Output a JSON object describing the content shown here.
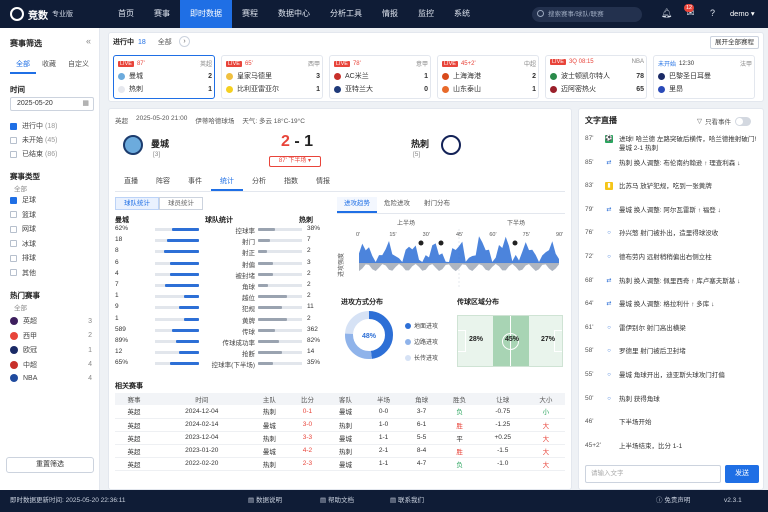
{
  "app": {
    "name": "竞数",
    "edition": "专业版"
  },
  "nav": [
    "首页",
    "赛事",
    "即时数据",
    "赛程",
    "数据中心",
    "分析工具",
    "情报",
    "监控",
    "系统"
  ],
  "search_placeholder": "搜索赛事/球队/联赛",
  "notif_count": "12",
  "user": "demo",
  "sidebar": {
    "title": "赛事筛选",
    "tabs": [
      "全部",
      "收藏",
      "自定义"
    ],
    "time_label": "时间",
    "date": "2025-05-20",
    "status": [
      {
        "label": "进行中",
        "count": "(18)",
        "checked": true
      },
      {
        "label": "未开始",
        "count": "(45)",
        "checked": false
      },
      {
        "label": "已结束",
        "count": "(86)",
        "checked": false
      }
    ],
    "type_label": "赛事类型",
    "all_label": "全部",
    "types": [
      {
        "label": "足球",
        "checked": true
      },
      {
        "label": "篮球",
        "checked": false
      },
      {
        "label": "网球",
        "checked": false
      },
      {
        "label": "冰球",
        "checked": false
      },
      {
        "label": "排球",
        "checked": false
      },
      {
        "label": "其他",
        "checked": false
      }
    ],
    "hot_label": "热门赛事",
    "hot_all": "全部",
    "leagues": [
      {
        "name": "英超",
        "n": "3",
        "color": "#3d1f5e"
      },
      {
        "name": "西甲",
        "n": "2",
        "color": "#e8443a"
      },
      {
        "name": "欧冠",
        "n": "1",
        "color": "#1a2a66"
      },
      {
        "name": "中超",
        "n": "4",
        "color": "#c8302a"
      },
      {
        "name": "NBA",
        "n": "4",
        "color": "#1f4a9e"
      }
    ],
    "reset": "重置筛选"
  },
  "live": {
    "label": "进行中",
    "count": "18",
    "all": "全部",
    "expand": "展开全部赛程",
    "matches": [
      {
        "tag": "LIVE",
        "min": "87'",
        "league": "英超",
        "home": "曼城",
        "hs": "2",
        "away": "热刺",
        "as": "1",
        "hc": "#6cabdd",
        "ac": "#e6e8ee"
      },
      {
        "tag": "LIVE",
        "min": "65'",
        "league": "西甲",
        "home": "皇家马德里",
        "hs": "3",
        "away": "比利亚雷亚尔",
        "as": "1",
        "hc": "#f0c040",
        "ac": "#f5d020"
      },
      {
        "tag": "LIVE",
        "min": "78'",
        "league": "意甲",
        "home": "AC米兰",
        "hs": "1",
        "away": "亚特兰大",
        "as": "0",
        "hc": "#c8302a",
        "ac": "#1f3a7a"
      },
      {
        "tag": "LIVE",
        "min": "45+2'",
        "league": "中超",
        "home": "上海海港",
        "hs": "2",
        "away": "山东泰山",
        "as": "1",
        "hc": "#d84a1b",
        "ac": "#e86a2a"
      },
      {
        "tag": "LIVE",
        "min": "3Q 08:15",
        "league": "NBA",
        "home": "波士顿凯尔特人",
        "hs": "78",
        "away": "迈阿密热火",
        "as": "65",
        "hc": "#2a8a4a",
        "ac": "#9a1f2a"
      },
      {
        "tag": "未开始",
        "min": "12:30",
        "league": "法甲",
        "home": "巴黎圣日耳曼",
        "hs": "",
        "away": "里昂",
        "as": "",
        "hc": "#1a2a66",
        "ac": "#2a4ab8"
      }
    ]
  },
  "match": {
    "league": "英超",
    "datetime": "2025-05-20 21:00",
    "venue": "伊蒂哈德球场",
    "weather_label": "天气:",
    "weather": "多云 18°C-19°C",
    "home": "曼城",
    "home_rank": "[3]",
    "away": "热刺",
    "away_rank": "[5]",
    "home_score": "2",
    "away_score": "1",
    "dash": "-",
    "period": "87' 下半场 ▾",
    "tabs": [
      "直播",
      "阵容",
      "事件",
      "统计",
      "分析",
      "指数",
      "情报"
    ],
    "active_tab": "统计",
    "sub_tabs": [
      "球队统计",
      "球员统计"
    ],
    "stat_home": "曼城",
    "stat_title": "球队统计",
    "stat_away": "热刺",
    "stats": [
      {
        "l": "62%",
        "name": "控球率",
        "r": "38%",
        "lf": 0.62,
        "rf": 0.38
      },
      {
        "l": "18",
        "name": "射门",
        "r": "7",
        "lf": 0.72,
        "rf": 0.28
      },
      {
        "l": "8",
        "name": "射正",
        "r": "2",
        "lf": 0.8,
        "rf": 0.2
      },
      {
        "l": "6",
        "name": "射偏",
        "r": "3",
        "lf": 0.67,
        "rf": 0.33
      },
      {
        "l": "4",
        "name": "被封堵",
        "r": "2",
        "lf": 0.67,
        "rf": 0.33
      },
      {
        "l": "7",
        "name": "角球",
        "r": "2",
        "lf": 0.78,
        "rf": 0.22
      },
      {
        "l": "1",
        "name": "越位",
        "r": "2",
        "lf": 0.33,
        "rf": 0.67
      },
      {
        "l": "9",
        "name": "犯规",
        "r": "11",
        "lf": 0.45,
        "rf": 0.55
      },
      {
        "l": "1",
        "name": "黄牌",
        "r": "2",
        "lf": 0.33,
        "rf": 0.67
      },
      {
        "l": "589",
        "name": "传球",
        "r": "362",
        "lf": 0.62,
        "rf": 0.38
      },
      {
        "l": "89%",
        "name": "传球成功率",
        "r": "82%",
        "lf": 0.52,
        "rf": 0.48
      },
      {
        "l": "12",
        "name": "抢断",
        "r": "14",
        "lf": 0.46,
        "rf": 0.54
      },
      {
        "l": "65%",
        "name": "控球率(下半场)",
        "r": "35%",
        "lf": 0.65,
        "rf": 0.35
      }
    ],
    "trend_tabs": [
      "进攻趋势",
      "危险进攻",
      "射门分布"
    ],
    "half1": "上半场",
    "half2": "下半场",
    "trend_axis": "进攻强度",
    "minutes": [
      "0'",
      "15'",
      "30'",
      "45'",
      "60'",
      "75'",
      "90'"
    ],
    "attack_title": "进攻方式分布",
    "attack_pct": "48%",
    "attack_legend": [
      {
        "name": "地面进攻",
        "color": "#2d6fd6"
      },
      {
        "name": "边路进攻",
        "color": "#8fb3ea"
      },
      {
        "name": "长传进攻",
        "color": "#d6e2f5"
      }
    ],
    "pass_title": "传球区域分布",
    "zones": [
      "28%",
      "45%",
      "27%"
    ],
    "related_title": "相关赛事",
    "related_cols": [
      "赛事",
      "时间",
      "主队",
      "比分",
      "客队",
      "半场",
      "角球",
      "胜负",
      "让球",
      "大小"
    ],
    "related": [
      [
        "英超",
        "2024-12-04",
        "热刺",
        "0-1",
        "曼城",
        "0-0",
        "3-7",
        "负",
        "-0.75",
        "小"
      ],
      [
        "英超",
        "2024-02-14",
        "曼城",
        "3-0",
        "热刺",
        "1-0",
        "6-1",
        "胜",
        "-1.25",
        "大"
      ],
      [
        "英超",
        "2023-12-04",
        "热刺",
        "3-3",
        "曼城",
        "1-1",
        "5-5",
        "平",
        "+0.25",
        "大"
      ],
      [
        "英超",
        "2023-01-20",
        "曼城",
        "4-2",
        "热刺",
        "2-1",
        "8-4",
        "胜",
        "-1.5",
        "大"
      ],
      [
        "英超",
        "2022-02-20",
        "热刺",
        "2-3",
        "曼城",
        "1-1",
        "4-7",
        "负",
        "-1.0",
        "大"
      ]
    ]
  },
  "textlive": {
    "title": "文字直播",
    "filter": "只看事件",
    "events": [
      {
        "t": "87'",
        "tx": "进球! 哈兰德 左路突破后横传，哈兰德推射破门! 曼城 2-1 热刺",
        "c": "#2aa55e",
        "ic": "⚽"
      },
      {
        "t": "85'",
        "tx": "热刺 换人调整: 布伦南约翰逊 ↑ 理查利森 ↓",
        "c": "#9aa3b0",
        "ic": "⇄"
      },
      {
        "t": "83'",
        "tx": "比苏马 放铲犯规，吃到一张黄牌",
        "c": "#f5c518",
        "ic": "▮"
      },
      {
        "t": "79'",
        "tx": "曼城 换人调整: 阿尔瓦雷斯 ↑ 福登 ↓",
        "c": "#9aa3b0",
        "ic": "⇄"
      },
      {
        "t": "76'",
        "tx": "孙兴慜 射门被扑出，造里得球没收",
        "c": "#9aa3b0",
        "ic": "○"
      },
      {
        "t": "72'",
        "tx": "德布劳内 远射稍稍偏出右侧立柱",
        "c": "#9aa3b0",
        "ic": "○"
      },
      {
        "t": "68'",
        "tx": "热刺 换人调整: 佩里西奇 ↑ 库卢塞夫斯基 ↓",
        "c": "#9aa3b0",
        "ic": "⇄"
      },
      {
        "t": "64'",
        "tx": "曼城 换人调整: 格拉利什 ↑ 多库 ↓",
        "c": "#9aa3b0",
        "ic": "⇄"
      },
      {
        "t": "61'",
        "tx": "雷伊别尔 射门高出横梁",
        "c": "#9aa3b0",
        "ic": "○"
      },
      {
        "t": "58'",
        "tx": "罗德里 射门被后卫封堵",
        "c": "#9aa3b0",
        "ic": "○"
      },
      {
        "t": "55'",
        "tx": "曼城 角球开出，迪亚斯头球攻门打偏",
        "c": "#9aa3b0",
        "ic": "○"
      },
      {
        "t": "50'",
        "tx": "热刺 获得角球",
        "c": "#9aa3b0",
        "ic": "○"
      },
      {
        "t": "46'",
        "tx": "下半场开始",
        "c": "#ffffff",
        "ic": ""
      },
      {
        "t": "45+2'",
        "tx": "上半场结束，比分 1-1",
        "c": "#ffffff",
        "ic": ""
      }
    ],
    "input_placeholder": "请输入文字",
    "send": "发送"
  },
  "footer": {
    "update": "即时数据更新时间: 2025-05-20 22:36:11",
    "links": [
      "数据说明",
      "帮助文档",
      "联系我们",
      "免责声明"
    ],
    "version": "v2.3.1"
  }
}
